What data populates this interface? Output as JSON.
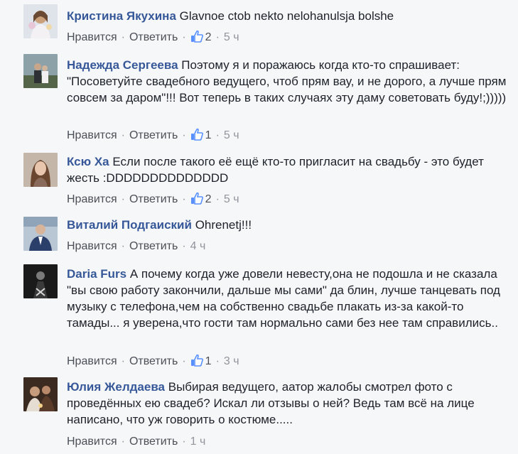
{
  "labels": {
    "like": "Нравится",
    "reply": "Ответить",
    "separator": "·"
  },
  "colors": {
    "author": "#365899",
    "meta": "#90949c",
    "like_icon": "#5890ff"
  },
  "comments": [
    {
      "author": "Кристина Якухина",
      "text": "Glavnoe ctob nekto nelohanulsja bolshe",
      "likes": "2",
      "time": "5 ч"
    },
    {
      "author": "Надежда Сергеева",
      "text": "Поэтому я и поражаюсь когда кто-то спрашивает: \"Посоветуйте свадебного ведущего, чтоб прям вау, и не дорого, а лучше прям совсем за даром\"!!! Вот теперь в таких случаях эту даму советовать буду!;)))))",
      "likes": "1",
      "time": "5 ч"
    },
    {
      "author": "Ксю Ха",
      "text": "Если после такого её ещё кто-то пригласит на свадьбу - это будет жесть :DDDDDDDDDDDDDD",
      "likes": "2",
      "time": "5 ч"
    },
    {
      "author": "Виталий Подгаиский",
      "text": "Ohrenetj!!!",
      "likes": "",
      "time": "4 ч"
    },
    {
      "author": "Daria Furs",
      "text": "А почему когда уже довели невесту,она не подошла и не сказала \"вы свою работу закончили, дальше мы сами\" да блин, лучше танцевать под музыку с телефона,чем на собственно свадьбе плакать из-за какой-то тамады... я уверена,что гости там нормально сами без нее там справились..",
      "likes": "1",
      "time": "3 ч"
    },
    {
      "author": "Юлия Желдаева",
      "text": "Выбирая ведущего, аатор жалобы смотрел фото с проведённых ею свадеб? Искал ли отзывы о ней? Ведь там всё на лице написано, что уж говорить о костюме.....",
      "likes": "",
      "time": "1 ч"
    }
  ]
}
